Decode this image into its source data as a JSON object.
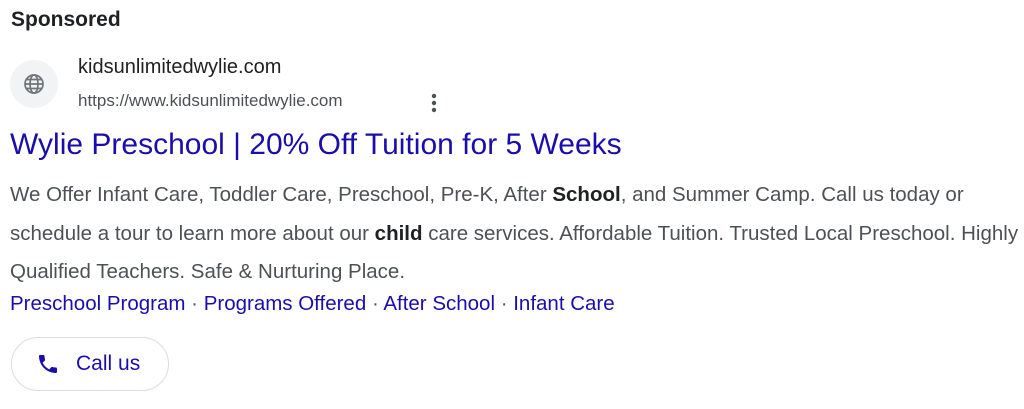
{
  "ad": {
    "sponsored_label": "Sponsored",
    "site_name": "kidsunlimitedwylie.com",
    "display_url": "https://www.kidsunlimitedwylie.com",
    "headline": "Wylie Preschool | 20% Off Tuition for 5 Weeks",
    "description": {
      "part1": "We Offer Infant Care, Toddler Care, Preschool, Pre-K, After ",
      "bold1": "School",
      "part2": ", and Summer Camp. Call us today or schedule a tour to learn more about our ",
      "bold2": "child",
      "part3": " care services. Affordable Tuition. Trusted Local Preschool. Highly Qualified Teachers. Safe & Nurturing Place."
    },
    "sitelinks": [
      "Preschool Program",
      "Programs Offered",
      "After School",
      "Infant Care"
    ],
    "separator": " · ",
    "call_button_label": "Call us"
  },
  "icons": {
    "favicon": "globe-icon",
    "menu": "more-vert-icon",
    "call": "phone-icon"
  },
  "colors": {
    "link": "#1a0dab",
    "text": "#4d5156",
    "heading": "#202124",
    "favicon_bg": "#f1f3f4",
    "border": "#dadce0"
  }
}
